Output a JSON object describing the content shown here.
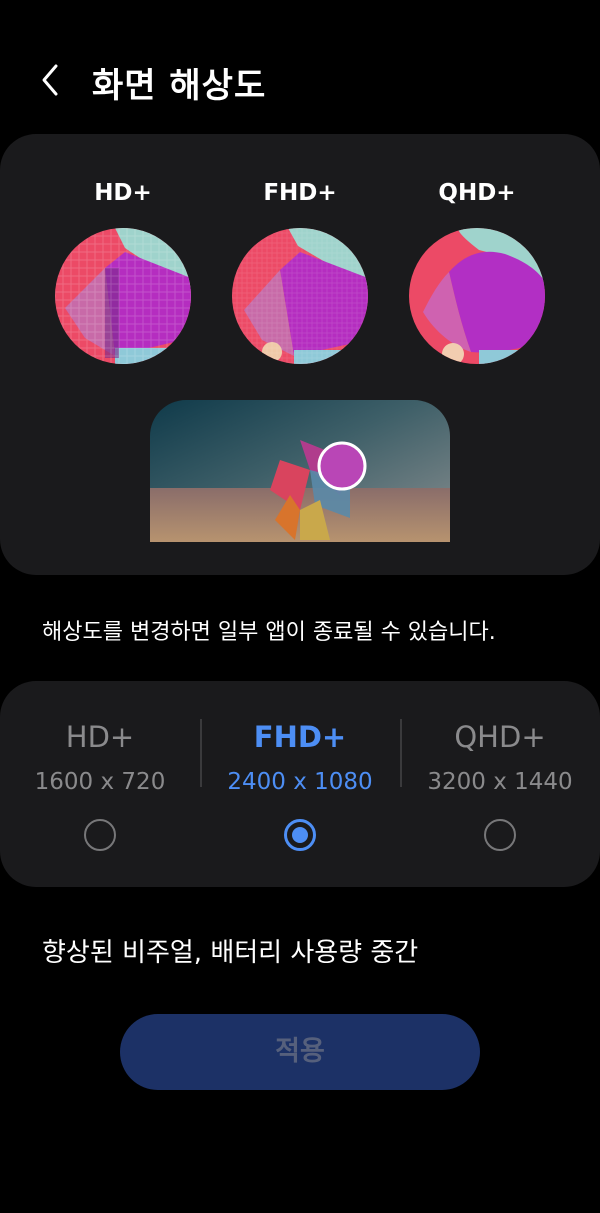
{
  "header": {
    "title": "화면 해상도",
    "back_icon": "chevron-left-icon"
  },
  "preview": {
    "items": [
      {
        "label": "HD+"
      },
      {
        "label": "FHD+"
      },
      {
        "label": "QHD+"
      }
    ]
  },
  "warning_text": "해상도를 변경하면 일부 앱이 종료될 수 있습니다.",
  "options": [
    {
      "name": "HD+",
      "dims": "1600 x 720",
      "selected": false
    },
    {
      "name": "FHD+",
      "dims": "2400 x 1080",
      "selected": true
    },
    {
      "name": "QHD+",
      "dims": "3200 x 1440",
      "selected": false
    }
  ],
  "description": "향상된 비주얼, 배터리 사용량 중간",
  "apply_label": "적용",
  "colors": {
    "accent": "#4d8ef4",
    "card_bg": "#1a1a1c",
    "apply_bg": "#1c3166",
    "apply_text": "#56607c"
  }
}
